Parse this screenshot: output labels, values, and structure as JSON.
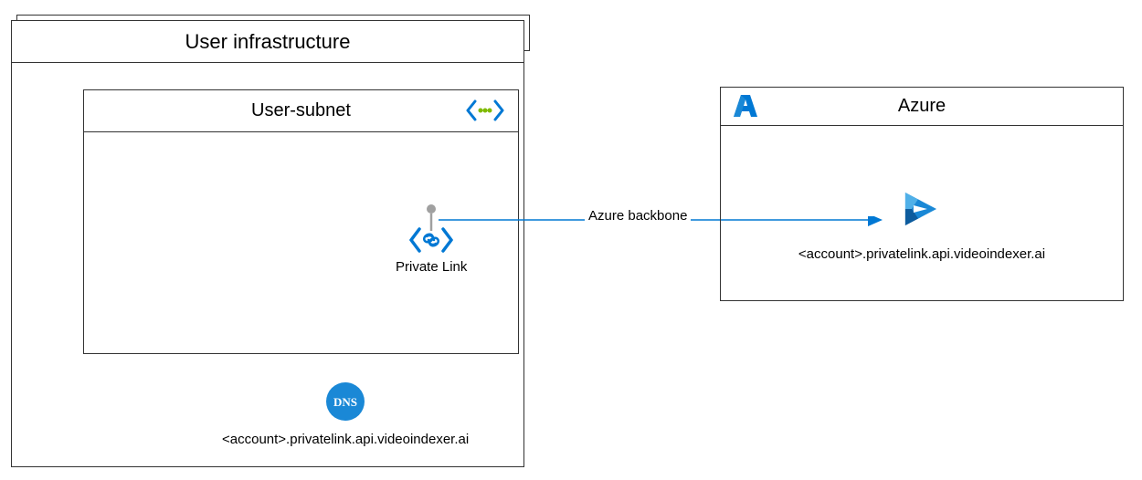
{
  "user_infrastructure": {
    "title": "User infrastructure",
    "user_subnet": {
      "title": "User-subnet",
      "private_link_label": "Private Link"
    },
    "dns_label": "<account>.privatelink.api.videoindexer.ai",
    "dns_icon_text": "DNS"
  },
  "azure": {
    "title": "Azure",
    "video_indexer_label": "<account>.privatelink.api.videoindexer.ai"
  },
  "connection": {
    "label": "Azure backbone"
  },
  "colors": {
    "azure_blue": "#0078d4",
    "azure_light_blue": "#50b0e8",
    "azure_green": "#7fba00"
  }
}
